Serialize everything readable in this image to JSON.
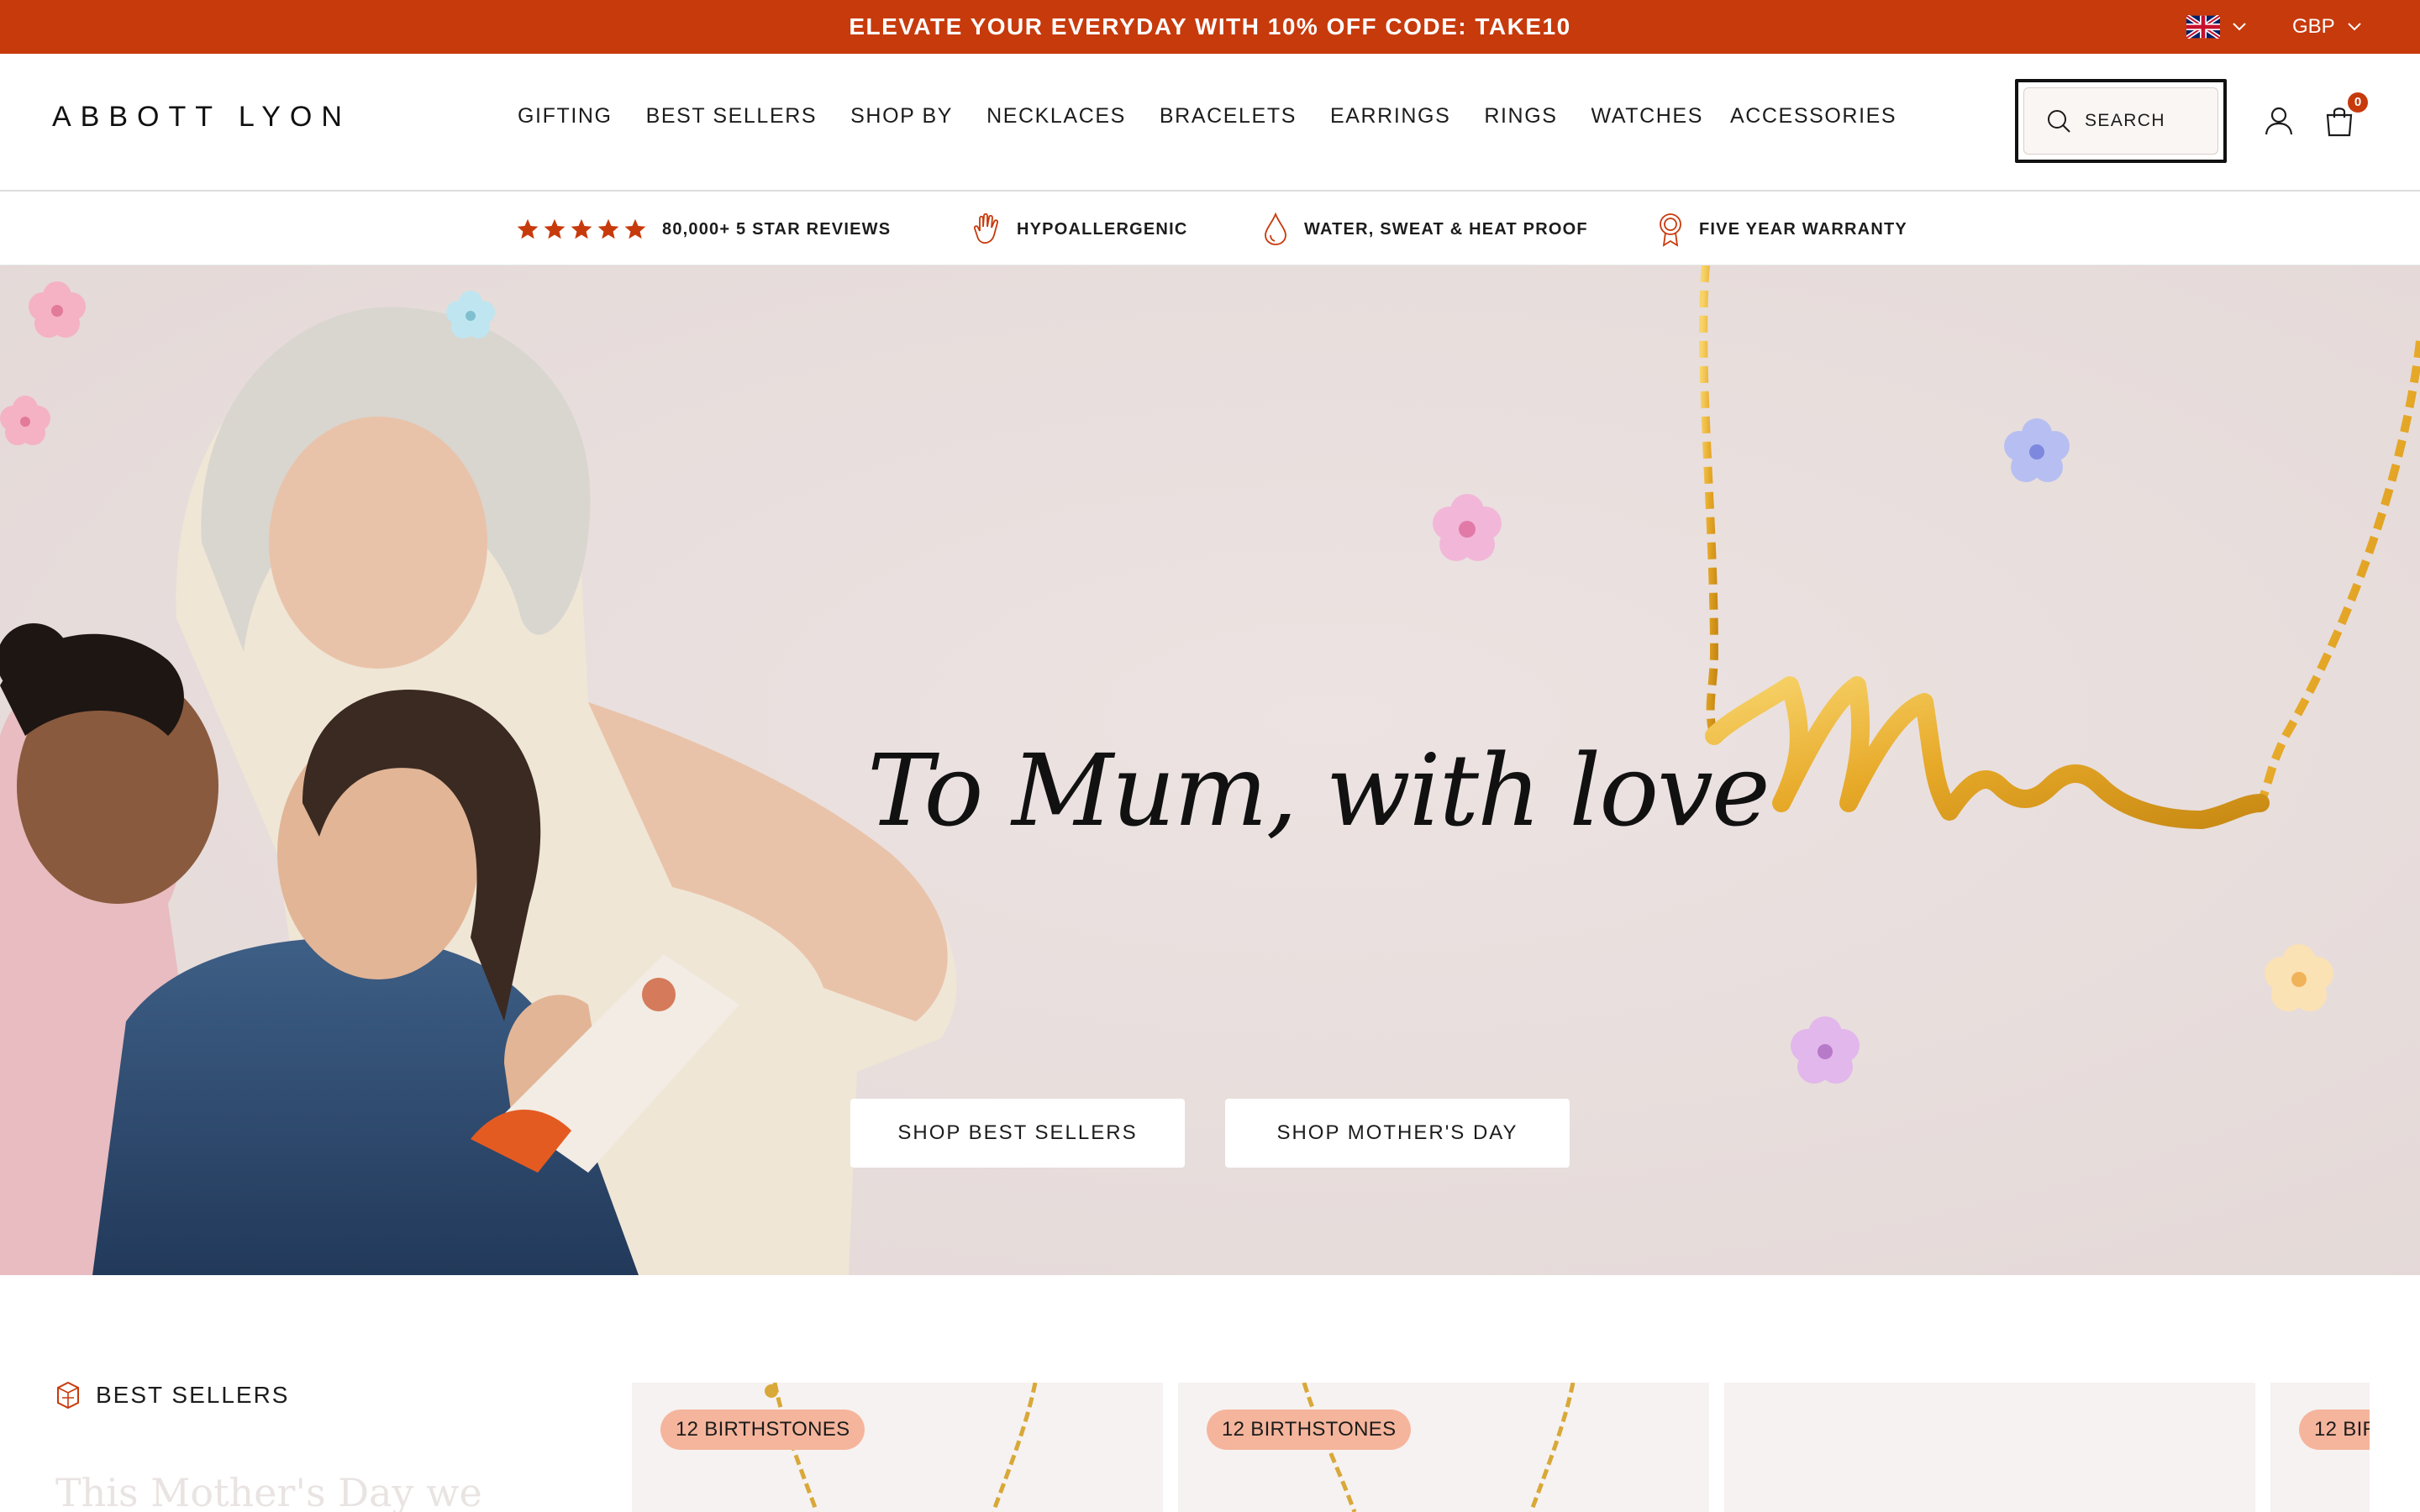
{
  "promo": {
    "text": "ELEVATE YOUR EVERYDAY WITH 10% OFF CODE: TAKE10",
    "background": "#c73a0c"
  },
  "locale": {
    "country_icon": "uk-flag-icon",
    "currency": "GBP"
  },
  "header": {
    "logo": "ABBOTT LYON",
    "nav": [
      "GIFTING",
      "BEST SELLERS",
      "SHOP BY",
      "NECKLACES",
      "BRACELETS",
      "EARRINGS",
      "RINGS",
      "WATCHES",
      "ACCESSORIES"
    ],
    "search_label": "SEARCH",
    "account_icon": "user-icon",
    "cart_icon": "bag-icon",
    "cart_count": "0"
  },
  "usps": {
    "reviews": "80,000+ 5 STAR REVIEWS",
    "hypoallergenic": "HYPOALLERGENIC",
    "water": "WATER, SWEAT & HEAT PROOF",
    "warranty": "FIVE YEAR WARRANTY",
    "star_count": 5
  },
  "hero": {
    "headline": "To Mum, with love",
    "buttons": {
      "best_sellers": "SHOP BEST SELLERS",
      "mothers_day": "SHOP MOTHER'S DAY"
    },
    "background": "#e8dedd"
  },
  "best_sellers": {
    "label": "BEST SELLERS",
    "subheading": "This Mother's Day we",
    "cards": [
      {
        "badge": "12 BIRTHSTONES"
      },
      {
        "badge": "12 BIRTHSTONES"
      },
      {
        "badge": ""
      },
      {
        "badge": "12 BIR"
      }
    ]
  },
  "colors": {
    "accent": "#c73a0c",
    "badge": "#f5b59c",
    "gold": "#e7b23a"
  }
}
